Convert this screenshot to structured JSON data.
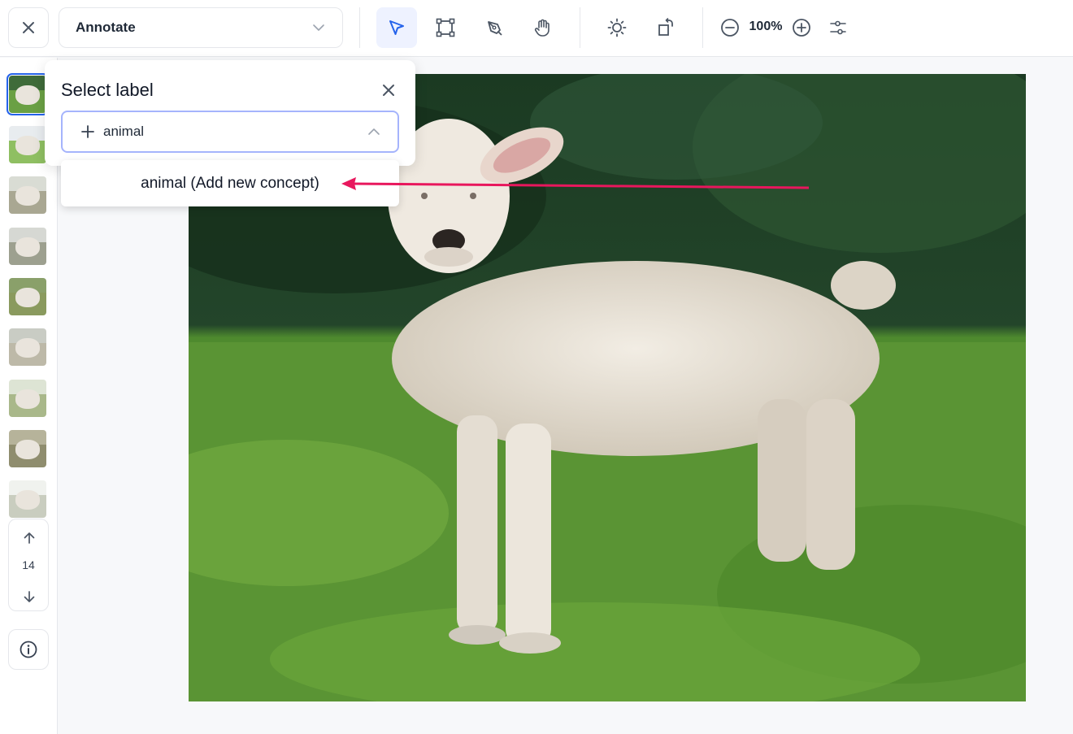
{
  "toolbar": {
    "mode_label": "Annotate",
    "zoom_level": "100%",
    "tools": [
      {
        "name": "select-tool",
        "icon": "cursor-icon",
        "active": true
      },
      {
        "name": "bbox-tool",
        "icon": "bounding-box-icon",
        "active": false
      },
      {
        "name": "pen-tool",
        "icon": "pen-icon",
        "active": false
      },
      {
        "name": "pan-tool",
        "icon": "hand-icon",
        "active": false
      },
      {
        "name": "brightness-tool",
        "icon": "sun-icon",
        "active": false
      },
      {
        "name": "rotate-tool",
        "icon": "rotate-icon",
        "active": false
      }
    ],
    "accent_color": "#2563eb"
  },
  "sidebar": {
    "thumbnail_count": 10,
    "selected_thumbnail_index": 0,
    "page_number": "14"
  },
  "label_popup": {
    "title": "Select label",
    "input_value": "animal",
    "option_label": "animal (Add new concept)"
  },
  "annotation": {
    "arrow_color": "#e8175d"
  }
}
